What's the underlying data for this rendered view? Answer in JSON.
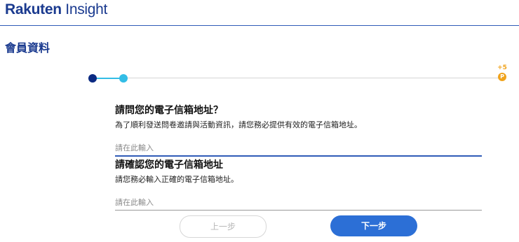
{
  "header": {
    "logo_brand": "Rakuten",
    "logo_sub": " Insight"
  },
  "page": {
    "title": "會員資料"
  },
  "progress": {
    "steps_total": 2,
    "current_step": 2,
    "reward_label": "+5",
    "reward_icon": "P"
  },
  "questions": [
    {
      "title": "請問您的電子信箱地址？",
      "description": "為了順利發送問卷邀請與活動資訊，請您務必提供有效的電子信箱地址。",
      "placeholder": "請在此輸入",
      "value": ""
    },
    {
      "title": "請確認您的電子信箱地址",
      "description": "請您務必輸入正確的電子信箱地址。",
      "placeholder": "請在此輸入",
      "value": ""
    }
  ],
  "buttons": {
    "prev_label": "上一步",
    "next_label": "下一步"
  },
  "colors": {
    "brand": "#1a3a8f",
    "accent": "#2c6fd6",
    "step_done": "#0b2a82",
    "step_current": "#33bde6",
    "reward": "#f0a31c"
  }
}
